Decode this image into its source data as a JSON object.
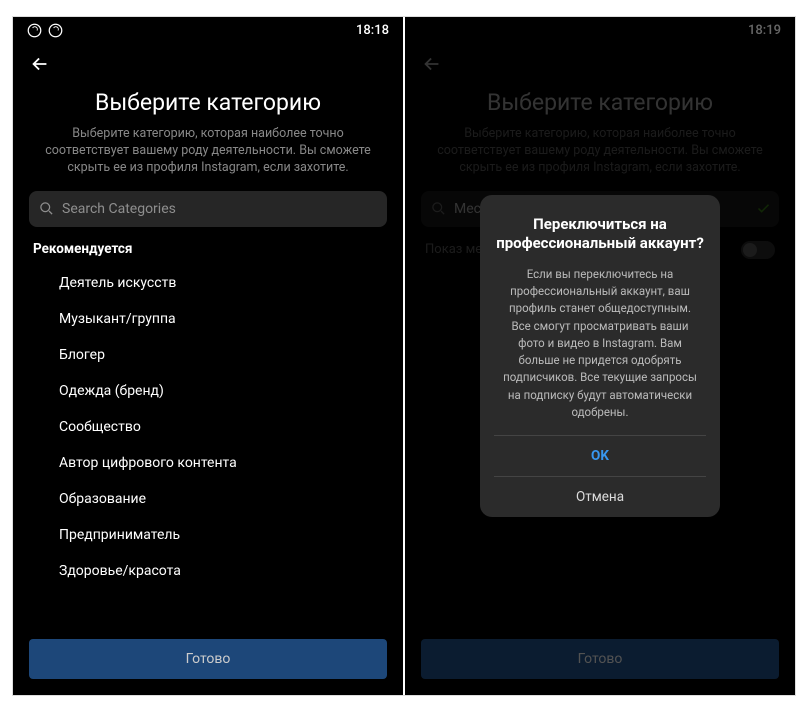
{
  "screen1": {
    "status_time": "18:18",
    "title": "Выберите категорию",
    "subtitle": "Выберите категорию, которая наиболее точно соответствует вашему роду деятельности. Вы сможете скрыть ее из профиля Instagram, если захотите.",
    "search_placeholder": "Search Categories",
    "section_heading": "Рекомендуется",
    "categories": [
      "Деятель искусств",
      "Музыкант/группа",
      "Блогер",
      "Одежда (бренд)",
      "Сообщество",
      "Автор цифрового контента",
      "Образование",
      "Предприниматель",
      "Здоровье/красота"
    ],
    "done_label": "Готово"
  },
  "screen2": {
    "status_time": "18:19",
    "title": "Выберите категорию",
    "subtitle": "Выберите категорию, которая наиболее точно соответствует вашему роду деятельности. Вы сможете скрыть ее из профиля Instagram, если захотите.",
    "search_value": "Мес",
    "toggle_label": "Показ мет",
    "done_label": "Готово",
    "dialog": {
      "title": "Переключиться на профессиональный аккаунт?",
      "body": "Если вы переключитесь на профессиональный аккаунт, ваш профиль станет общедоступным. Все смогут просматривать ваши фото и видео в Instagram. Вам больше не придется одобрять подписчиков. Все текущие запросы на подписку будут автоматически одобрены.",
      "ok_label": "OK",
      "cancel_label": "Отмена"
    }
  }
}
